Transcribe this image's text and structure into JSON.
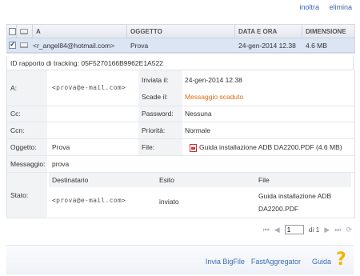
{
  "top_links": {
    "forward": "inoltra",
    "delete": "elimina"
  },
  "table": {
    "headers": {
      "to": "A",
      "subject": "OGGETTO",
      "date": "DATA E ORA",
      "size": "DIMENSIONE"
    },
    "row": {
      "to": "<r_angel84@hotmail.com>",
      "subject": "Prova",
      "date": "24-gen-2014 12.38",
      "size": "4.6 MB"
    }
  },
  "tracking": "ID rapporto di tracking: 05F5270166B9962E1A522",
  "details": {
    "to_label": "A:",
    "to_value": "<prova@e-mail.com>",
    "sent_label": "Inviata il:",
    "sent_value": "24-gen-2014 12.38",
    "expires_label": "Scade il:",
    "expires_value": "Messaggio scaduto",
    "cc_label": "Cc:",
    "password_label": "Password:",
    "password_value": "Nessuna",
    "bcc_label": "Ccn:",
    "priority_label": "Priorità:",
    "priority_value": "Normale",
    "subject_label": "Oggetto:",
    "subject_value": "Prova",
    "file_label": "File:",
    "file_value": "Guida installazione ADB DA2200.PDF (4.6 MB)",
    "message_label": "Messaggio:",
    "message_value": "prova",
    "status_label": "Stato:",
    "status_table": {
      "headers": {
        "recipient": "Destinatario",
        "outcome": "Esito",
        "file": "File"
      },
      "row": {
        "recipient": "<prova@e-mail.com>",
        "outcome": "inviato",
        "file_line1": "Guida installazione ADB",
        "file_line2": "DA2200.PDF"
      }
    }
  },
  "pager": {
    "page": "1",
    "of": "di 1"
  },
  "footer_links": {
    "bigfile": "Invia BigFile",
    "aggregator": "FastAggregator",
    "help": "Guida"
  },
  "colors": {
    "link": "#3a6cb0",
    "selected_row": "#dbe5f4",
    "warning": "#e06a10",
    "help_icon": "#f4b400"
  },
  "icons": [
    "envelope-icon",
    "pdf-icon",
    "first-page-icon",
    "prev-page-icon",
    "next-page-icon",
    "last-page-icon",
    "refresh-icon",
    "help-icon"
  ]
}
